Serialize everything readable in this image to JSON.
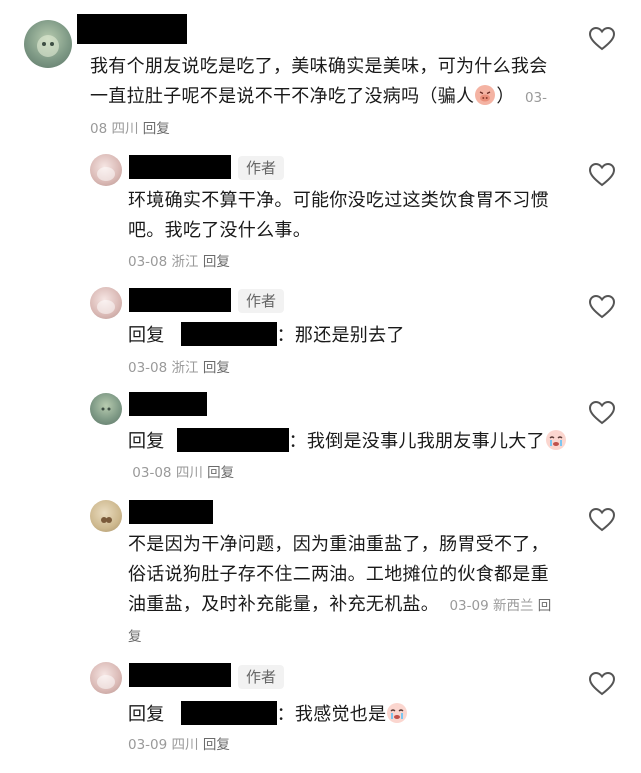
{
  "comments": [
    {
      "text": "我有个朋友说吃是吃了，美味确实是美味，可为什么我会一直拉肚子呢不是说不干不净吃了没病吗（骗人",
      "text_tail": "）",
      "emoji": "pig-face-emoji",
      "date": "03-08",
      "location": "四川",
      "reply_label": "回复"
    },
    {
      "author_badge": "作者",
      "text": "环境确实不算干净。可能你没吃过这类饮食胃不习惯吧。我吃了没什么事。",
      "date": "03-08",
      "location": "浙江",
      "reply_label": "回复"
    },
    {
      "author_badge": "作者",
      "reply_prefix": "回复",
      "text": "：那还是别去了",
      "date": "03-08",
      "location": "浙江",
      "reply_label": "回复"
    },
    {
      "reply_prefix": "回复",
      "text": "：我倒是没事儿我朋友事儿大了",
      "emoji": "crying-face-emoji",
      "date": "03-08",
      "location": "四川",
      "reply_label": "回复"
    },
    {
      "text": "不是因为干净问题，因为重油重盐了，肠胃受不了，俗话说狗肚子存不住二两油。工地摊位的伙食都是重油重盐，及时补充能量，补充无机盐。",
      "date": "03-09",
      "location": "新西兰",
      "reply_label": "回复"
    },
    {
      "author_badge": "作者",
      "reply_prefix": "回复",
      "text": "：我感觉也是",
      "emoji": "crying-face-emoji",
      "date": "03-09",
      "location": "四川",
      "reply_label": "回复"
    }
  ],
  "icons": {
    "like": "heart-outline-icon"
  },
  "colors": {
    "meta_text": "#9a9a9a",
    "badge_bg": "#f2f2f2",
    "redaction": "#000000"
  }
}
